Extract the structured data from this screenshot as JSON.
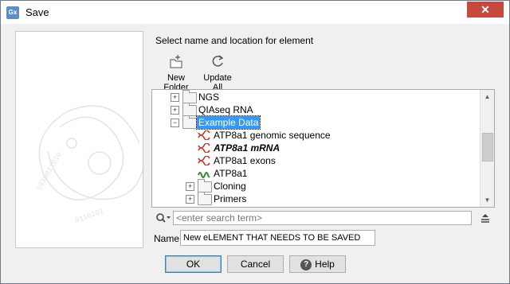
{
  "window": {
    "title": "Save",
    "app_icon_text": "Gx",
    "close_symbol": "✕"
  },
  "main": {
    "section_label": "Select name and location for element",
    "toolbar": {
      "new_folder_label": "New Folder",
      "update_all_label": "Update All"
    },
    "tree": {
      "items": [
        {
          "label": "NGS",
          "type": "folder",
          "expander": "+"
        },
        {
          "label": "QIAseq RNA",
          "type": "folder",
          "expander": "+"
        },
        {
          "label": "Example Data",
          "type": "folder-open",
          "expander": "−",
          "selected": true
        },
        {
          "label": "ATP8a1 genomic sequence",
          "type": "sequence-dna"
        },
        {
          "label": "ATP8a1 mRNA",
          "type": "sequence-dna",
          "bold_italic": true
        },
        {
          "label": "ATP8a1 exons",
          "type": "sequence-dna"
        },
        {
          "label": "ATP8a1",
          "type": "sequence-protein"
        },
        {
          "label": "Cloning",
          "type": "folder",
          "expander": "+"
        },
        {
          "label": "Primers",
          "type": "folder",
          "expander": "+"
        }
      ]
    },
    "search": {
      "placeholder": "<enter search term>"
    },
    "name_field": {
      "label": "Name:",
      "value": "New eLEMENT THAT NEEDS TO BE SAVED"
    }
  },
  "buttons": {
    "ok_label": "OK",
    "cancel_label": "Cancel",
    "help_label": "Help",
    "help_icon": "?"
  },
  "colors": {
    "selection": "#3399ff",
    "dna_icon": "#c0392b",
    "protein_icon": "#2e8b2e",
    "close_button": "#c7493d"
  }
}
